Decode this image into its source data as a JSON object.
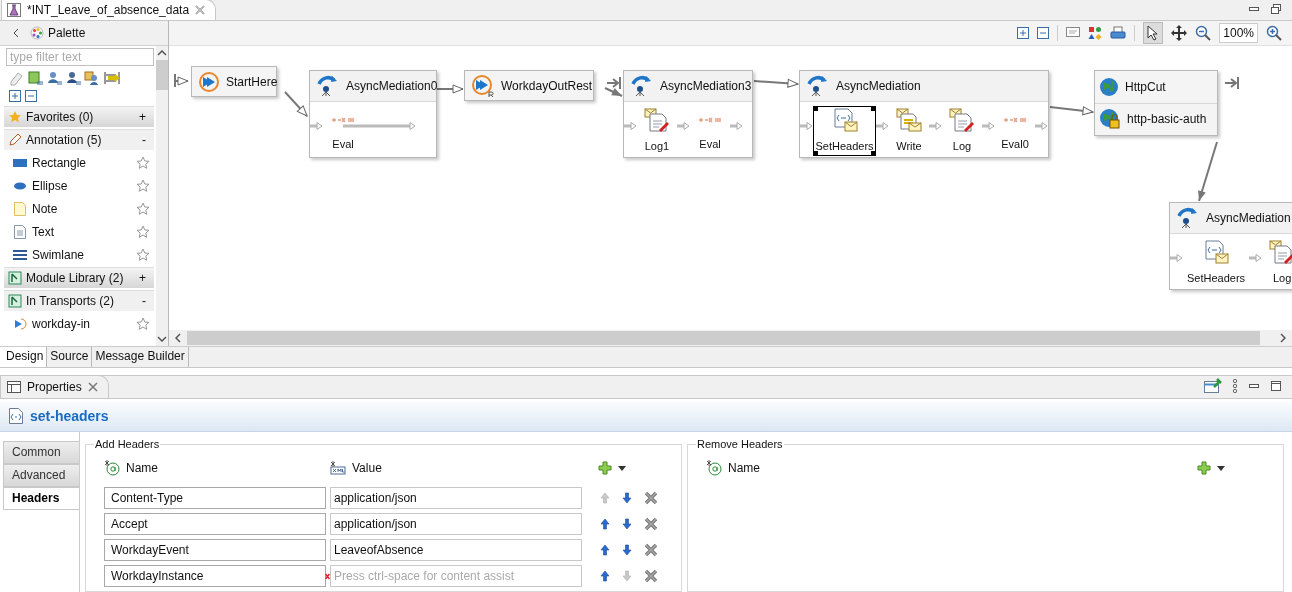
{
  "editor_tab": {
    "title": "*INT_Leave_of_absence_data"
  },
  "toolbar": {
    "zoom": "100%"
  },
  "palette": {
    "title": "Palette",
    "filter": {
      "placeholder": "type filter text"
    },
    "items": [
      {
        "kind": "drawer",
        "label": "Favorites (0)",
        "toggle": "+",
        "expanded": false
      },
      {
        "kind": "drawer",
        "label": "Annotation (5)",
        "toggle": "-",
        "expanded": true
      },
      {
        "kind": "rectangle",
        "label": "Rectangle"
      },
      {
        "kind": "ellipse",
        "label": "Ellipse"
      },
      {
        "kind": "note",
        "label": "Note"
      },
      {
        "kind": "text",
        "label": "Text"
      },
      {
        "kind": "swimlane",
        "label": "Swimlane"
      },
      {
        "kind": "drawer",
        "label": "Module Library (2)",
        "toggle": "+",
        "expanded": false
      },
      {
        "kind": "drawer",
        "label": "In Transports (2)",
        "toggle": "-",
        "expanded": true
      },
      {
        "kind": "transport",
        "label": "workday-in"
      }
    ]
  },
  "diagram": {
    "nodes": [
      {
        "kind": "start",
        "title": "StartHere"
      },
      {
        "kind": "mediation",
        "title": "AsyncMediation0",
        "steps": [
          {
            "kind": "eval",
            "label": "Eval",
            "selected": false
          }
        ]
      },
      {
        "kind": "rest",
        "title": "WorkdayOutRest"
      },
      {
        "kind": "mediation",
        "title": "AsyncMediation3",
        "steps": [
          {
            "kind": "log",
            "label": "Log1",
            "selected": false
          },
          {
            "kind": "eval",
            "label": "Eval",
            "selected": false
          }
        ]
      },
      {
        "kind": "mediation",
        "title": "AsyncMediation",
        "steps": [
          {
            "kind": "headers",
            "label": "SetHeaders",
            "selected": true
          },
          {
            "kind": "write",
            "label": "Write",
            "selected": false
          },
          {
            "kind": "log",
            "label": "Log",
            "selected": false
          },
          {
            "kind": "eval",
            "label": "Eval0",
            "selected": false
          }
        ]
      },
      {
        "kind": "http",
        "title": "HttpCut",
        "sub": "http-basic-auth"
      },
      {
        "kind": "mediation",
        "title": "AsyncMediation",
        "steps": [
          {
            "kind": "headers",
            "label": "SetHeaders",
            "selected": false
          },
          {
            "kind": "log",
            "label": "Log",
            "selected": false
          }
        ]
      }
    ]
  },
  "editor_tabs": [
    {
      "label": "Design",
      "selected": true
    },
    {
      "label": "Source",
      "selected": false
    },
    {
      "label": "Message Builder",
      "selected": false
    }
  ],
  "properties": {
    "title": "Properties",
    "heading": "set-headers",
    "tabs": [
      {
        "label": "Common",
        "selected": false
      },
      {
        "label": "Advanced",
        "selected": false
      },
      {
        "label": "Headers",
        "selected": true
      }
    ],
    "add_headers": {
      "title": "Add Headers",
      "columns": [
        "Name",
        "Value"
      ],
      "rows": [
        {
          "name": "Content-Type",
          "value": "application/json",
          "up_enabled": false,
          "down_enabled": true,
          "error": false
        },
        {
          "name": "Accept",
          "value": "application/json",
          "up_enabled": true,
          "down_enabled": true,
          "error": false
        },
        {
          "name": "WorkdayEvent",
          "value": "LeaveofAbsence",
          "up_enabled": true,
          "down_enabled": true,
          "error": false
        },
        {
          "name": "WorkdayInstance",
          "placeholder": "Press ctrl-space for content assist",
          "up_enabled": true,
          "down_enabled": false,
          "error": true
        }
      ]
    },
    "remove_headers": {
      "title": "Remove Headers",
      "columns": [
        "Name"
      ]
    }
  }
}
